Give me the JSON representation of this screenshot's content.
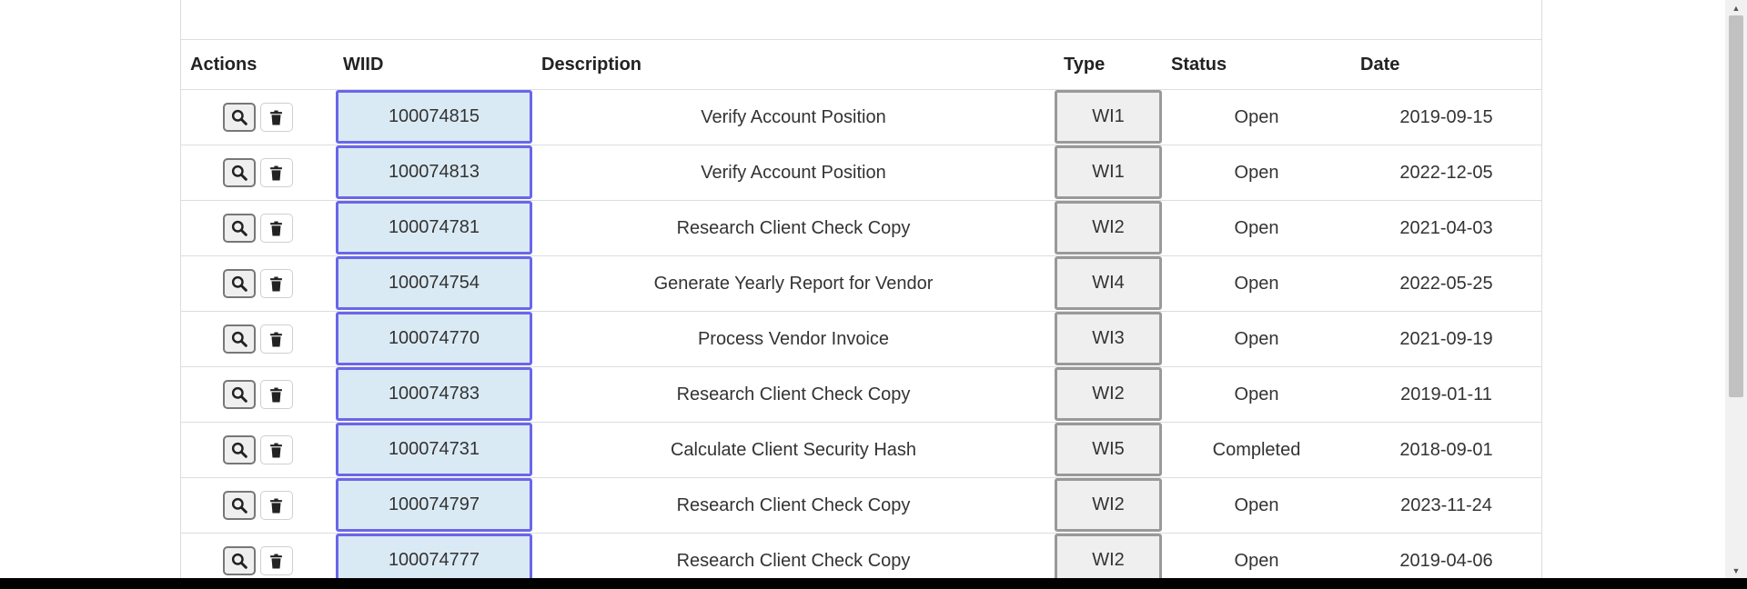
{
  "table": {
    "headers": {
      "actions": "Actions",
      "wiid": "WIID",
      "description": "Description",
      "type": "Type",
      "status": "Status",
      "date": "Date"
    },
    "rows": [
      {
        "wiid": "100074815",
        "description": "Verify Account Position",
        "type": "WI1",
        "status": "Open",
        "date": "2019-09-15"
      },
      {
        "wiid": "100074813",
        "description": "Verify Account Position",
        "type": "WI1",
        "status": "Open",
        "date": "2022-12-05"
      },
      {
        "wiid": "100074781",
        "description": "Research Client Check Copy",
        "type": "WI2",
        "status": "Open",
        "date": "2021-04-03"
      },
      {
        "wiid": "100074754",
        "description": "Generate Yearly Report for Vendor",
        "type": "WI4",
        "status": "Open",
        "date": "2022-05-25"
      },
      {
        "wiid": "100074770",
        "description": "Process Vendor Invoice",
        "type": "WI3",
        "status": "Open",
        "date": "2021-09-19"
      },
      {
        "wiid": "100074783",
        "description": "Research Client Check Copy",
        "type": "WI2",
        "status": "Open",
        "date": "2019-01-11"
      },
      {
        "wiid": "100074731",
        "description": "Calculate Client Security Hash",
        "type": "WI5",
        "status": "Completed",
        "date": "2018-09-01"
      },
      {
        "wiid": "100074797",
        "description": "Research Client Check Copy",
        "type": "WI2",
        "status": "Open",
        "date": "2023-11-24"
      },
      {
        "wiid": "100074777",
        "description": "Research Client Check Copy",
        "type": "WI2",
        "status": "Open",
        "date": "2019-04-06"
      }
    ],
    "icons": {
      "view": "search-icon",
      "delete": "trash-icon"
    }
  },
  "colors": {
    "wiid_fill": "#daeaf4",
    "wiid_border": "#6a66ea",
    "type_fill": "#efefef",
    "type_border": "#999999"
  }
}
